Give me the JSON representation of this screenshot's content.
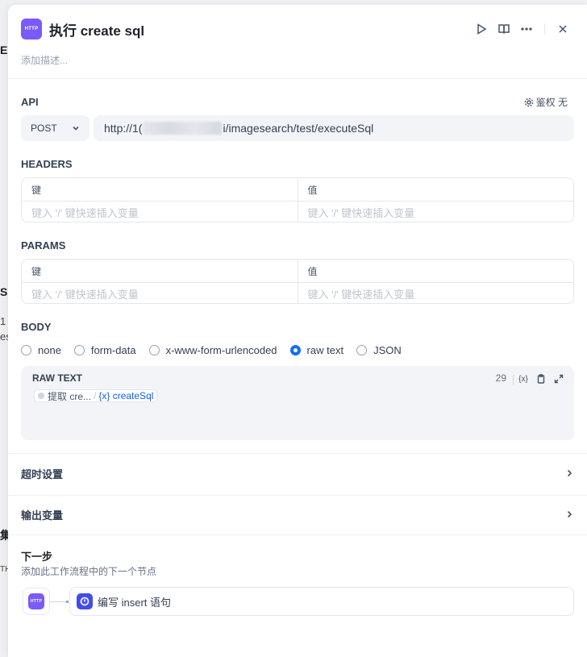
{
  "background_fragments": [
    "E",
    "SC",
    "1",
    "es",
    "集",
    "TH"
  ],
  "node": {
    "badge": "HTTP",
    "title": "执行 create sql",
    "description_placeholder": "添加描述..."
  },
  "api": {
    "label": "API",
    "auth_label": "鉴权 无",
    "method": "POST",
    "url_prefix": "http://1(",
    "url_suffix": "i/imagesearch/test/executeSql"
  },
  "headers": {
    "label": "HEADERS",
    "key_header": "键",
    "value_header": "值",
    "key_placeholder": "键入 '/' 键快速插入变量",
    "value_placeholder": "键入 '/' 键快速插入变量"
  },
  "params": {
    "label": "PARAMS",
    "key_header": "键",
    "value_header": "值",
    "key_placeholder": "键入 '/' 键快速插入变量",
    "value_placeholder": "键入 '/' 键快速插入变量"
  },
  "body": {
    "label": "BODY",
    "types": [
      "none",
      "form-data",
      "x-www-form-urlencoded",
      "raw text",
      "JSON"
    ],
    "selected": "raw text",
    "raw_title": "RAW TEXT",
    "char_count": "29",
    "var_node": "提取 cre...",
    "var_name": "{x} createSql",
    "var_icon": "{x}"
  },
  "timeout": {
    "label": "超时设置"
  },
  "output": {
    "label": "输出变量"
  },
  "next": {
    "title": "下一步",
    "description": "添加此工作流程中的下一个节点",
    "source_badge": "HTTP",
    "target_label": "编写 insert 语句"
  },
  "colors": {
    "node_badge": "#7a5af8",
    "radio_selected": "#1570ef",
    "variable_text": "#155eef",
    "next_node_icon": "#444ce7"
  }
}
